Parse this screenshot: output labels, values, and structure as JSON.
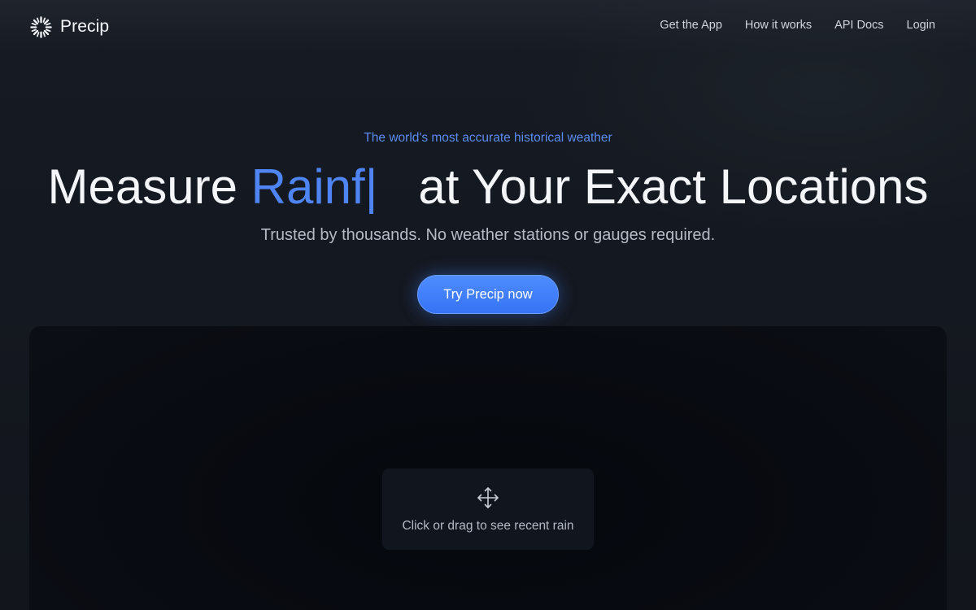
{
  "app": {
    "brand_name": "Precip",
    "brand_icon": "spinner-sunburst-icon"
  },
  "nav": {
    "links": [
      "Get the App",
      "How it works",
      "API Docs",
      "Login"
    ]
  },
  "hero": {
    "eyebrow": "The world's most accurate historical weather",
    "headline_prefix": "Measure ",
    "headline_typed": "Rainf",
    "headline_cursor": "|",
    "headline_suffix": "at Your Exact Locations",
    "subhead": "Trusted by thousands. No weather stations or gauges required.",
    "cta_label": "Try Precip now"
  },
  "map": {
    "hint_icon": "move-arrows-icon",
    "hint_text": "Click or drag to see recent rain"
  },
  "colors": {
    "accent": "#4f85f2",
    "background": "#141820",
    "cta": "#3d7ef7"
  }
}
